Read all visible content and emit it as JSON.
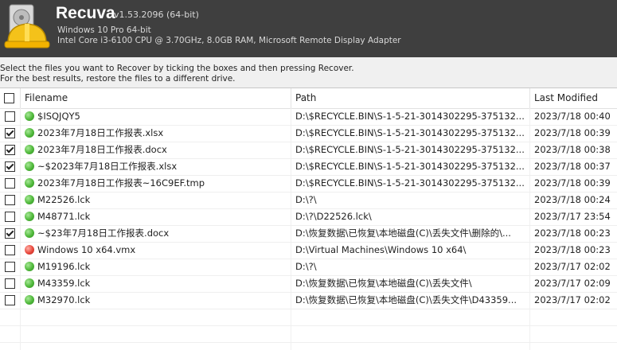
{
  "app": {
    "name": "Recuva",
    "version": "v1.53.2096 (64-bit)",
    "os": "Windows 10 Pro 64-bit",
    "hardware": "Intel Core i3-6100 CPU @ 3.70GHz, 8.0GB RAM, Microsoft Remote Display Adapter"
  },
  "instructions": {
    "line1": "Select the files you want to Recover by ticking the boxes and then pressing Recover.",
    "line2": "For the best results, restore the files to a different drive."
  },
  "table": {
    "columns": {
      "filename": "Filename",
      "path": "Path",
      "modified": "Last Modified"
    },
    "rows": [
      {
        "checked": false,
        "status": "green",
        "filename": "$ISQJQY5",
        "path": "D:\\$RECYCLE.BIN\\S-1-5-21-3014302295-375132...",
        "modified": "2023/7/18 00:40"
      },
      {
        "checked": true,
        "status": "green",
        "filename": "2023年7月18日工作报表.xlsx",
        "path": "D:\\$RECYCLE.BIN\\S-1-5-21-3014302295-375132...",
        "modified": "2023/7/18 00:39"
      },
      {
        "checked": true,
        "status": "green",
        "filename": "2023年7月18日工作报表.docx",
        "path": "D:\\$RECYCLE.BIN\\S-1-5-21-3014302295-375132...",
        "modified": "2023/7/18 00:38"
      },
      {
        "checked": true,
        "status": "green",
        "filename": "~$2023年7月18日工作报表.xlsx",
        "path": "D:\\$RECYCLE.BIN\\S-1-5-21-3014302295-375132...",
        "modified": "2023/7/18 00:37"
      },
      {
        "checked": false,
        "status": "green",
        "filename": "2023年7月18日工作报表~16C9EF.tmp",
        "path": "D:\\$RECYCLE.BIN\\S-1-5-21-3014302295-375132...",
        "modified": "2023/7/18 00:39"
      },
      {
        "checked": false,
        "status": "green",
        "filename": "M22526.lck",
        "path": "D:\\?\\",
        "modified": "2023/7/18 00:24"
      },
      {
        "checked": false,
        "status": "green",
        "filename": "M48771.lck",
        "path": "D:\\?\\D22526.lck\\",
        "modified": "2023/7/17 23:54"
      },
      {
        "checked": true,
        "status": "green",
        "filename": "~$23年7月18日工作报表.docx",
        "path": "D:\\恢复数据\\已恢复\\本地磁盘(C)\\丢失文件\\删除的\\...",
        "modified": "2023/7/18 00:23"
      },
      {
        "checked": false,
        "status": "red",
        "filename": "Windows 10 x64.vmx",
        "path": "D:\\Virtual Machines\\Windows 10 x64\\",
        "modified": "2023/7/18 00:23"
      },
      {
        "checked": false,
        "status": "green",
        "filename": "M19196.lck",
        "path": "D:\\?\\",
        "modified": "2023/7/17 02:02"
      },
      {
        "checked": false,
        "status": "green",
        "filename": "M43359.lck",
        "path": "D:\\恢复数据\\已恢复\\本地磁盘(C)\\丢失文件\\",
        "modified": "2023/7/17 02:09"
      },
      {
        "checked": false,
        "status": "green",
        "filename": "M32970.lck",
        "path": "D:\\恢复数据\\已恢复\\本地磁盘(C)\\丢失文件\\D43359...",
        "modified": "2023/7/17 02:02"
      }
    ]
  }
}
